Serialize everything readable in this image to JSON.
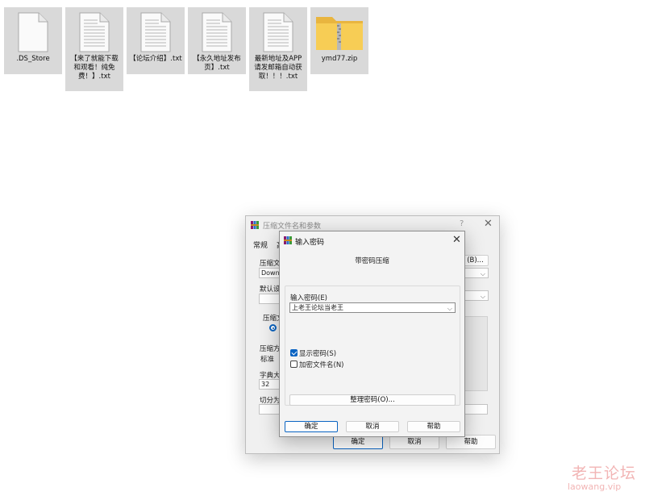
{
  "files": [
    {
      "name": ".DS_Store",
      "icon": "blank-file-icon"
    },
    {
      "name": "【来了就能下载和观看！纯免费！】.txt",
      "icon": "text-file-icon"
    },
    {
      "name": "【论坛介绍】.txt",
      "icon": "text-file-icon"
    },
    {
      "name": "【永久地址发布页】.txt",
      "icon": "text-file-icon"
    },
    {
      "name": "最新地址及APP请发邮箱自动获取！！！.txt",
      "icon": "text-file-icon"
    },
    {
      "name": "ymd77.zip",
      "icon": "zip-folder-icon"
    }
  ],
  "archive_dialog": {
    "title": "压缩文件名和参数",
    "help_q": "?",
    "close": "✕",
    "tab_general": "常规",
    "tab_advanced": "高",
    "archive_name_label": "压缩文",
    "archive_name_value": "Downl",
    "browse_button": "(B)...",
    "default_label": "默认设",
    "format_label": "压缩文",
    "method_label": "压缩方",
    "method_value": "标准",
    "dict_label": "字典大",
    "dict_value": "32",
    "split_label": "切分为",
    "ok": "确定",
    "cancel": "取消",
    "help": "帮助"
  },
  "password_dialog": {
    "title": "输入密码",
    "close": "✕",
    "heading": "带密码压缩",
    "password_label": "输入密码(E)",
    "password_value": "上老王论坛当老王",
    "show_password_label": "显示密码(S)",
    "show_password_checked": true,
    "encrypt_names_label": "加密文件名(N)",
    "encrypt_names_checked": false,
    "organize_button": "整理密码(O)...",
    "ok": "确定",
    "cancel": "取消",
    "help": "帮助"
  },
  "watermark": {
    "cn": "老王论坛",
    "url": "laowang.vip"
  },
  "colors": {
    "accent": "#0a64c2",
    "tile_bg": "#d9d9d9",
    "watermark": "#f2b5b5"
  }
}
